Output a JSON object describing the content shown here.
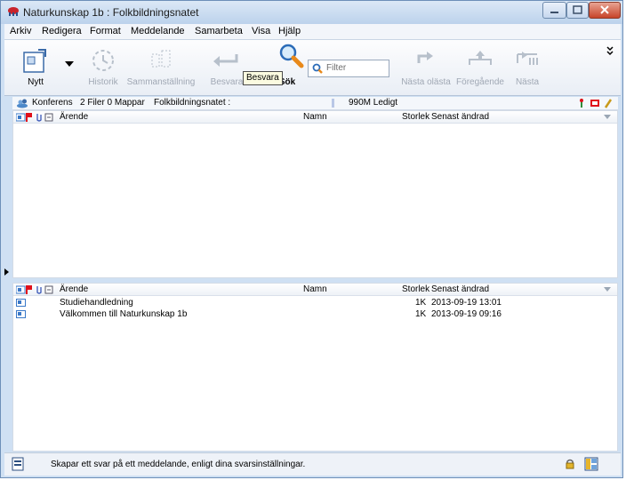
{
  "window": {
    "title": "Naturkunskap 1b : Folkbildningsnatet"
  },
  "menu": [
    "Arkiv",
    "Redigera",
    "Format",
    "Meddelande",
    "Samarbeta",
    "Visa",
    "Hjälp"
  ],
  "toolbar": {
    "new_label": "Nytt",
    "history_label": "Historik",
    "summary_label": "Sammanställning",
    "reply_label": "Besvara",
    "search_label": "Sök",
    "tooltip": "Besvara",
    "filter_placeholder": "Filter",
    "next_unread_label": "Nästa olästa",
    "previous_label": "Föregående",
    "next_label": "Nästa"
  },
  "infobar": {
    "conference": "Konferens",
    "counts": "2 Filer 0 Mappar",
    "path": "Folkbildningsnatet :",
    "free": "990M Ledigt"
  },
  "columns": {
    "subject": "Ärende",
    "name": "Namn",
    "size": "Storlek",
    "modified": "Senast ändrad"
  },
  "files": [
    {
      "subject": "Studiehandledning",
      "name": "",
      "size": "1K",
      "modified": "2013-09-19  13:01"
    },
    {
      "subject": "Välkommen till Naturkunskap 1b",
      "name": "",
      "size": "1K",
      "modified": "2013-09-19  09:16"
    }
  ],
  "status": {
    "text": "Skapar ett svar på ett meddelande, enligt dina svarsinställningar."
  },
  "colors": {
    "accent": "#3a78c8",
    "flag": "#e0101a"
  }
}
